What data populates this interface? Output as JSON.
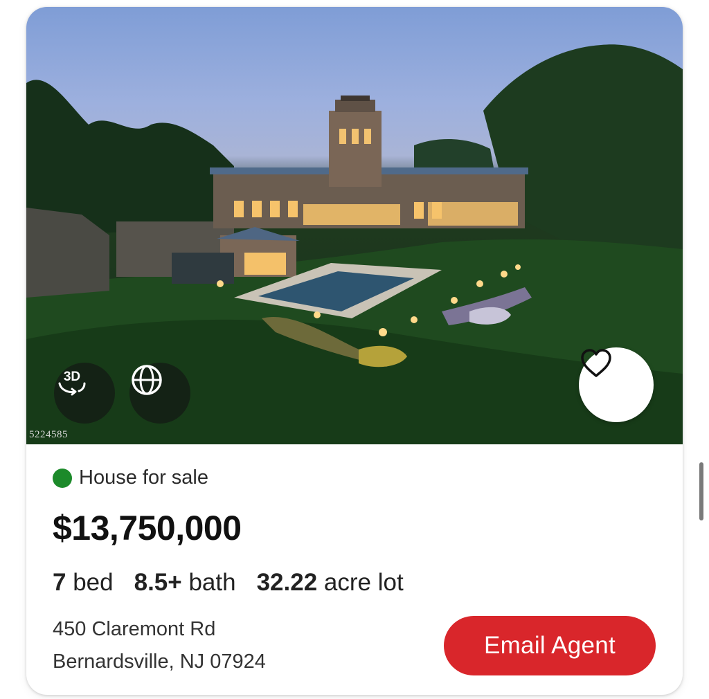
{
  "listing": {
    "photo_id": "5224585",
    "status_label": "House for sale",
    "status_color": "#1c8a2a",
    "price": "$13,750,000",
    "beds_value": "7",
    "beds_unit": "bed",
    "baths_value": "8.5+",
    "baths_unit": "bath",
    "lot_value": "32.22",
    "lot_unit": "acre lot",
    "address_line1": "450 Claremont Rd",
    "address_line2": "Bernardsville, NJ 07924"
  },
  "buttons": {
    "tour_3d_label": "3D",
    "email_agent_label": "Email Agent",
    "email_agent_color": "#d9262b"
  },
  "icons": {
    "tour": "3d-tour-icon",
    "globe": "globe-icon",
    "favorite": "heart-icon"
  }
}
